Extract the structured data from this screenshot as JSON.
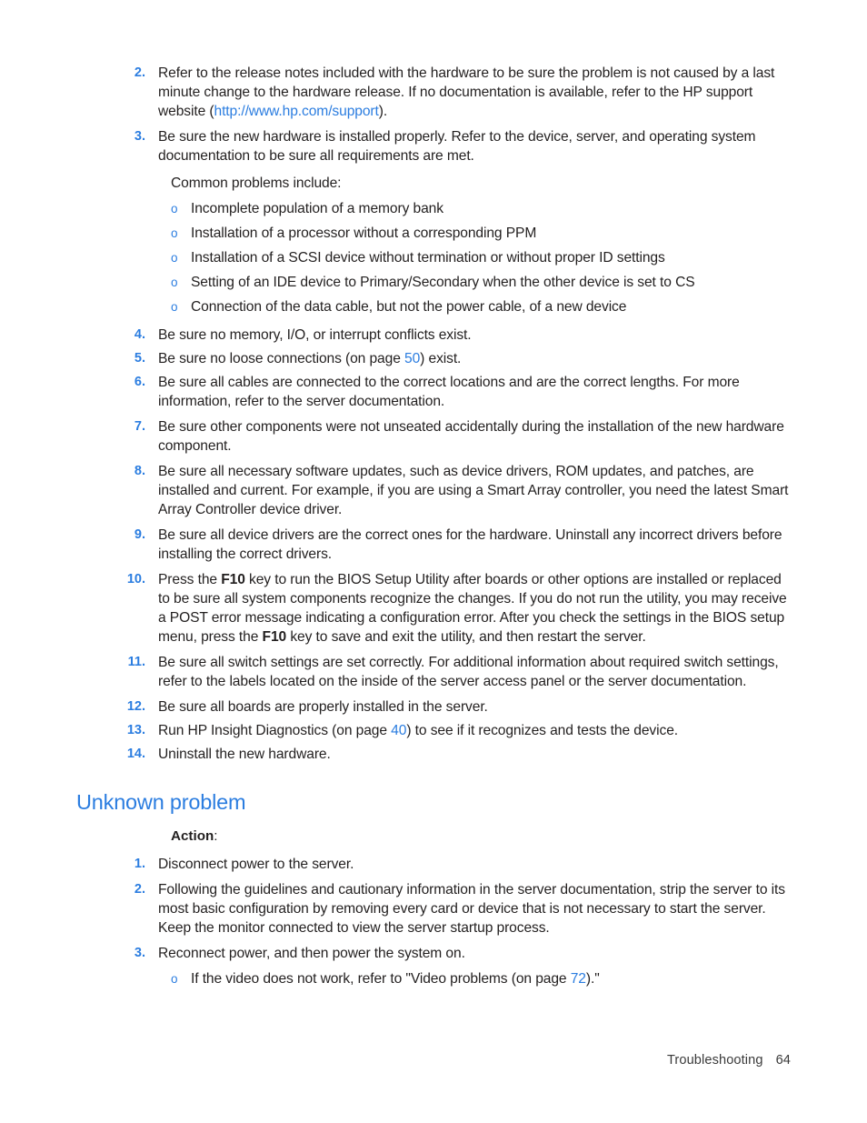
{
  "document": {
    "footer": {
      "section": "Troubleshooting",
      "page_number": "64"
    }
  },
  "colors": {
    "link_blue": "#2b7de0",
    "body_text": "#221f1f"
  },
  "continued_list": {
    "items": [
      {
        "number": "2.",
        "text_before_link": "Refer to the release notes included with the hardware to be sure the problem is not caused by a last minute change to the hardware release. If no documentation is available, refer to the HP support website (",
        "link": "http://www.hp.com/support",
        "text_after_link": ")."
      },
      {
        "number": "3.",
        "text": "Be sure the new hardware is installed properly. Refer to the device, server, and operating system documentation to be sure all requirements are met."
      }
    ],
    "common_problems_intro": "Common problems include:",
    "common_problems": [
      "Incomplete population of a memory bank",
      "Installation of a processor without a corresponding PPM",
      "Installation of a SCSI device without termination or without proper ID settings",
      "Setting of an IDE device to Primary/Secondary when the other device is set to CS",
      "Connection of the data cable, but not the power cable, of a new device"
    ],
    "items_continued": [
      {
        "number": "4.",
        "text": "Be sure no memory, I/O, or interrupt conflicts exist."
      },
      {
        "number": "5.",
        "text_before_xref": "Be sure no loose connections (on page ",
        "xref": "50",
        "text_after_xref": ") exist."
      },
      {
        "number": "6.",
        "text": "Be sure all cables are connected to the correct locations and are the correct lengths. For more information, refer to the server documentation."
      },
      {
        "number": "7.",
        "text": "Be sure other components were not unseated accidentally during the installation of the new hardware component."
      },
      {
        "number": "8.",
        "text": "Be sure all necessary software updates, such as device drivers, ROM updates, and patches, are installed and current. For example, if you are using a Smart Array controller, you need the latest Smart Array Controller device driver."
      },
      {
        "number": "9.",
        "text": "Be sure all device drivers are the correct ones for the hardware. Uninstall any incorrect drivers before installing the correct drivers."
      },
      {
        "number": "10.",
        "part1": "Press the ",
        "bold1": "F10",
        "part2": " key to run the BIOS Setup Utility after boards or other options are installed or replaced to be sure all system components recognize the changes. If you do not run the utility, you may receive a POST error message indicating a configuration error. After you check the settings in the BIOS setup menu, press the ",
        "bold2": "F10",
        "part3": " key to save and exit the utility, and then restart the server."
      },
      {
        "number": "11.",
        "text": "Be sure all switch settings are set correctly. For additional information about required switch settings, refer to the labels located on the inside of the server access panel or the server documentation."
      },
      {
        "number": "12.",
        "text": "Be sure all boards are properly installed in the server."
      },
      {
        "number": "13.",
        "text_before_xref": "Run HP Insight Diagnostics (on page ",
        "xref": "40",
        "text_after_xref": ") to see if it recognizes and tests the device."
      },
      {
        "number": "14.",
        "text": "Uninstall the new hardware."
      }
    ]
  },
  "unknown_problem": {
    "heading": "Unknown problem",
    "action_label": "Action",
    "action_colon": ":",
    "steps": [
      {
        "number": "1.",
        "text": "Disconnect power to the server."
      },
      {
        "number": "2.",
        "text": "Following the guidelines and cautionary information in the server documentation, strip the server to its most basic configuration by removing every card or device that is not necessary to start the server. Keep the monitor connected to view the server startup process."
      },
      {
        "number": "3.",
        "text": "Reconnect power, and then power the system on."
      }
    ],
    "substeps": [
      {
        "text_before_xref": "If the video does not work, refer to \"Video problems (on page ",
        "xref": "72",
        "text_after_xref": ").\""
      }
    ]
  },
  "icons": {
    "bullet_o": "o"
  }
}
